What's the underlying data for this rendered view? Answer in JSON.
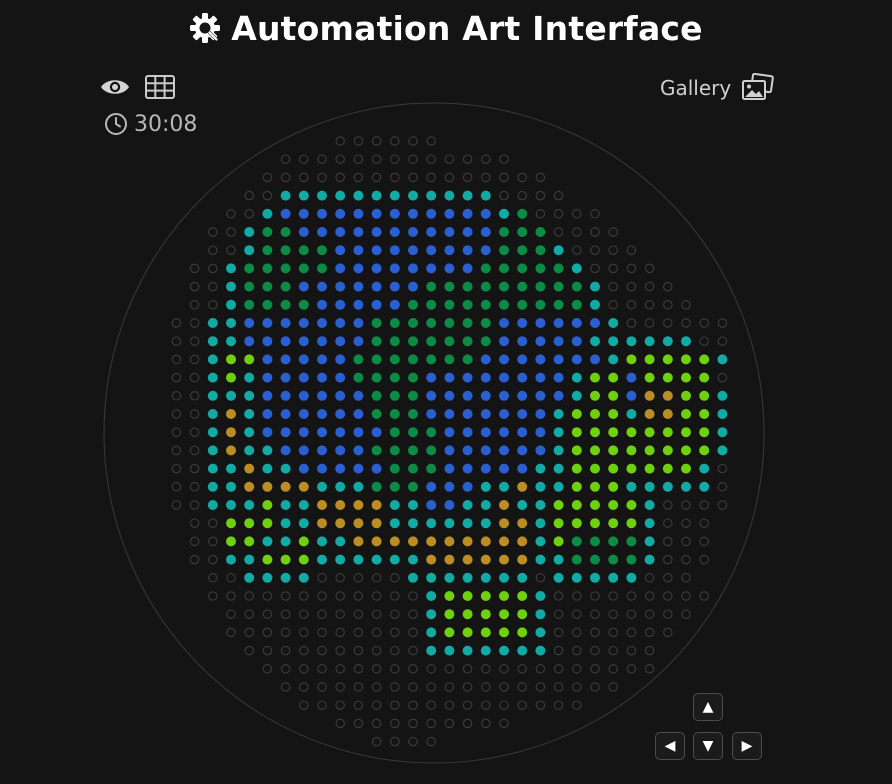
{
  "app": {
    "title": "Automation Art Interface",
    "logo_icon": "gear-icon"
  },
  "toolbar": {
    "view_icon": "eye-icon",
    "grid_icon": "grid-icon",
    "timer_icon": "clock-icon",
    "timer_value": "30:08",
    "gallery_label": "Gallery",
    "gallery_icon": "gallery-icon"
  },
  "controls": {
    "up": "▲",
    "left": "◀",
    "down": "▼",
    "right": "▶"
  },
  "palette": {
    "background": "#141414",
    "empty_ring": "#3d3d3d",
    "boundary": "#3a3a3a",
    "colors": {
      "T": "#12aaa4",
      "B": "#2a5fd2",
      "G": "#0b8b45",
      "Y": "#6fd00e",
      "O": "#bc8d22"
    }
  },
  "pixel_grid": {
    "cols": 33,
    "rows": 34,
    "rows_data": [
      "...........______................",
      "........_____________............",
      ".......________________..........",
      "......__TTTTTTTTTTTT____.........",
      ".....__TBBBBBBBBBBBBTG____.......",
      "....__TGGBBBBBBBBBBBGGG____......",
      "....__TGGGGBBBBBBBBBGGGT____.....",
      "...__TGGGGGBBBBBBBBGGGGGT____....",
      "...__TGGGBBBBBBBGGGGGGGGGT____...",
      "...__TGGGGBBBBBGGGGGGGGGGT_____..",
      "..__TTBBBBBBBGGGGGGGBBBBBBT______",
      "..__TTBBBBBBBGGGGGGGBBBBBTTTTTT__",
      "..__TYYBBBBBGGGGGGGBBBBBBBTYYYYYT",
      "..__TYTBBBBBGGGGBBBBBBBBTYYBYYYY_",
      "..__TTTBBBBBBGGGBBBBBBBBTYYBOOYYT",
      "..__TOTBBBBBBGGGBBBBBBBTYYYTOOYYT",
      "..__TOTBBBBBBBGGGBBBBBBTYYYYYYYYT",
      "..__TOTTBBBBBGGGGBBBBBBTYYYYYYYYT",
      "..__TTOTTBBBBBGGGBBBBBTTYYYYYYYT_",
      "..__TTOOOOTTTGGGBBBTTOTTYYYTTTTT_",
      "..__TTTYTTOOOOTTBBTTOTTYYYYYT____",
      "...__YYYTTOOOOTTTTTTOOTYYYYYT___.",
      "...__YYTTYTTOOOOOOOOOOTYGGGGT___.",
      "...__TTYYYTTTTTTOOOOOOTTGGGGT___.",
      "....__TTTT_____TTTTTTT_TTTTT___..",
      "....____________TYYYYYT_________.",
      ".....___________TYYYYYT________..",
      ".....___________TYYYYYT_______...",
      "......__________TTTTTTT______....",
      ".......______________________....",
      "........___________________......",
      ".........________________........",
      "...........__________............",
      ".............____................"
    ]
  }
}
